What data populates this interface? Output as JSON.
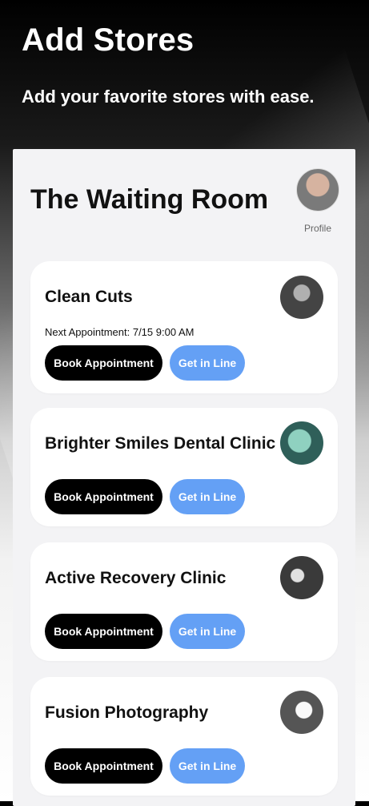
{
  "hero": {
    "title": "Add Stores",
    "subtitle": "Add your favorite stores with ease."
  },
  "panel": {
    "title": "The Waiting Room",
    "profile_label": "Profile"
  },
  "stores": [
    {
      "name": "Clean Cuts",
      "next_appointment": "Next Appointment: 7/15 9:00 AM",
      "book_label": "Book Appointment",
      "line_label": "Get in Line",
      "image": "barbershop-image"
    },
    {
      "name": "Brighter Smiles Dental Clinic",
      "book_label": "Book Appointment",
      "line_label": "Get in Line",
      "image": "dental-image"
    },
    {
      "name": "Active Recovery Clinic",
      "book_label": "Book Appointment",
      "line_label": "Get in Line",
      "image": "clinic-image"
    },
    {
      "name": "Fusion Photography",
      "book_label": "Book Appointment",
      "line_label": "Get in Line",
      "image": "photography-image"
    }
  ],
  "colors": {
    "accent_blue": "#64a0f5",
    "button_black": "#000000",
    "panel_bg": "#f3f3f5"
  }
}
